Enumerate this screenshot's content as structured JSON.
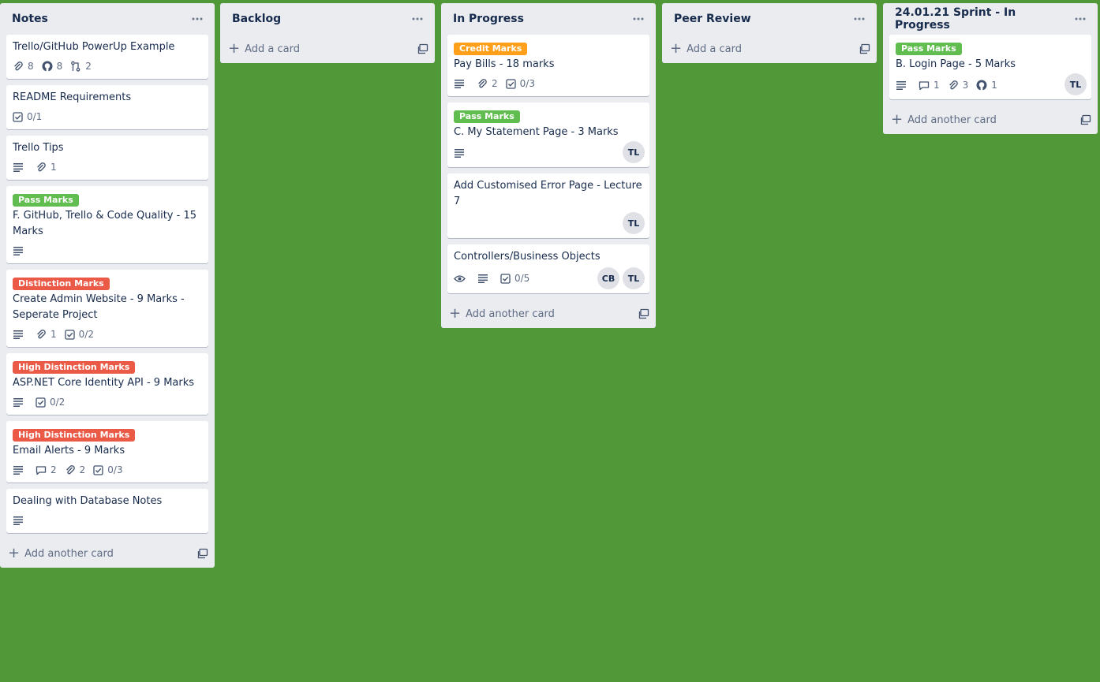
{
  "labels": {
    "pass": {
      "text": "Pass Marks",
      "color": "#61bd4f"
    },
    "credit": {
      "text": "Credit Marks",
      "color": "#ff9f1a"
    },
    "distinction": {
      "text": "Distinction Marks",
      "color": "#eb5a46"
    },
    "high_distinction": {
      "text": "High Distinction Marks",
      "color": "#eb5a46"
    }
  },
  "icons": {
    "more": "more-icon",
    "attachment": "paperclip-icon",
    "github": "github-icon",
    "pull_request": "pull-request-icon",
    "checklist": "checklist-icon",
    "description": "description-icon",
    "comment": "comment-icon",
    "watch": "eye-icon",
    "template": "card-template-icon",
    "add": "plus-icon"
  },
  "lists": [
    {
      "title": "Notes",
      "add_label": "Add another card",
      "cards": [
        {
          "title": "Trello/GitHub PowerUp Example",
          "attachments": "8",
          "github": "8",
          "pull_requests": "2"
        },
        {
          "title": "README Requirements",
          "checklist": "0/1"
        },
        {
          "title": "Trello Tips",
          "attachments": "1"
        },
        {
          "label": "Pass Marks",
          "title": "F. GitHub, Trello & Code Quality - 15 Marks"
        },
        {
          "label": "Distinction Marks",
          "title": "Create Admin Website - 9 Marks - Seperate Project",
          "attachments": "1",
          "checklist": "0/2"
        },
        {
          "label": "High Distinction Marks",
          "title": "ASP.NET Core Identity API - 9 Marks",
          "checklist": "0/2"
        },
        {
          "label": "High Distinction Marks",
          "title": "Email Alerts - 9 Marks",
          "comments": "2",
          "attachments": "2",
          "checklist": "0/3"
        },
        {
          "title": "Dealing with Database Notes"
        }
      ]
    },
    {
      "title": "Backlog",
      "add_label": "Add a card",
      "cards": []
    },
    {
      "title": "In Progress",
      "add_label": "Add another card",
      "cards": [
        {
          "label": "Credit Marks",
          "title": "Pay Bills - 18 marks",
          "attachments": "2",
          "checklist": "0/3"
        },
        {
          "label": "Pass Marks",
          "title": "C. My Statement Page - 3 Marks",
          "members": [
            "TL"
          ]
        },
        {
          "title": "Add Customised Error Page - Lecture 7",
          "members": [
            "TL"
          ]
        },
        {
          "title": "Controllers/Business Objects",
          "checklist": "0/5",
          "members": [
            "CB",
            "TL"
          ]
        }
      ]
    },
    {
      "title": "Peer Review",
      "add_label": "Add a card",
      "cards": []
    },
    {
      "title": "24.01.21 Sprint - In Progress",
      "add_label": "Add another card",
      "cards": [
        {
          "label": "Pass Marks",
          "title": "B. Login Page - 5 Marks",
          "comments": "1",
          "attachments": "3",
          "github": "1",
          "members": [
            "TL"
          ]
        }
      ]
    }
  ]
}
